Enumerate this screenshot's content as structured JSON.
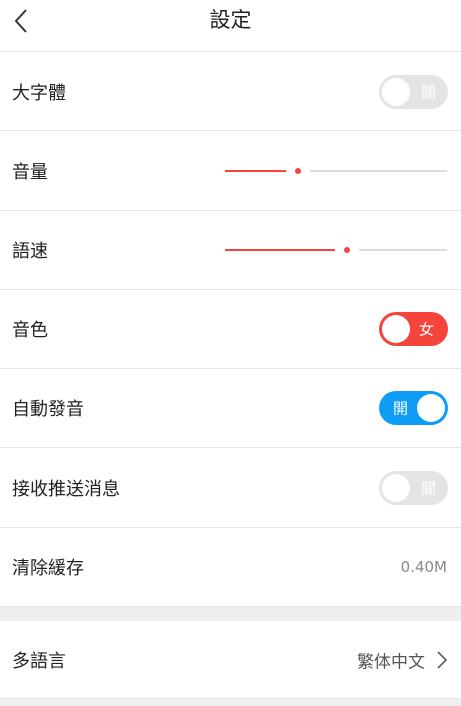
{
  "header": {
    "title": "設定"
  },
  "rows": {
    "large_font": {
      "label": "大字體",
      "toggle_text": "關"
    },
    "volume": {
      "label": "音量",
      "level": 0.33
    },
    "speed": {
      "label": "語速",
      "level": 0.55
    },
    "voice": {
      "label": "音色",
      "toggle_text": "女"
    },
    "auto_play": {
      "label": "自動發音",
      "toggle_text": "開"
    },
    "push": {
      "label": "接收推送消息",
      "toggle_text": "關"
    },
    "cache": {
      "label": "清除緩存",
      "value": "0.40M"
    },
    "language": {
      "label": "多語言",
      "value": "繁体中文"
    }
  },
  "colors": {
    "accent_red": "#f4443c",
    "accent_blue": "#0f9cf5",
    "toggle_off": "#e4e4e4",
    "track_grey": "#dcdcdc"
  },
  "icons": {
    "back": "chevron-left-icon",
    "more": "chevron-right-icon"
  }
}
